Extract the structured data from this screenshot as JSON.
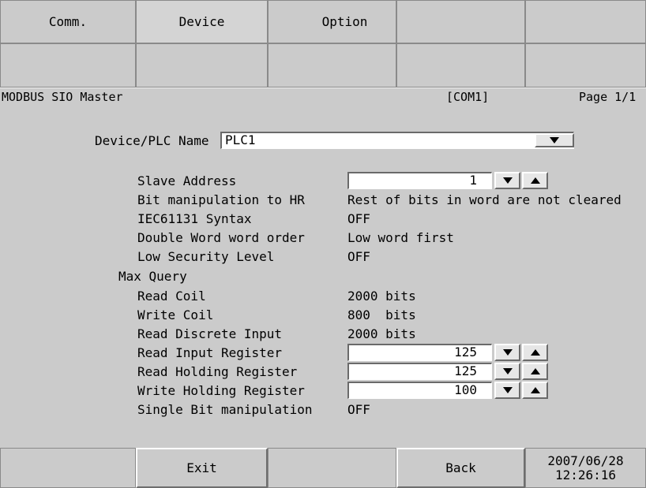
{
  "tabs": [
    {
      "label": "Comm."
    },
    {
      "label": "Device"
    },
    {
      "label": "Option"
    }
  ],
  "header": {
    "driver": "MODBUS SIO Master",
    "port": "[COM1]",
    "page": "Page 1/1"
  },
  "device": {
    "label": "Device/PLC Name",
    "value": "PLC1"
  },
  "settings": {
    "slave_address": {
      "label": "Slave Address",
      "value": "1"
    },
    "bit_manipulation": {
      "label": "Bit manipulation to HR",
      "value": "Rest of bits in word are not cleared"
    },
    "iec_syntax": {
      "label": "IEC61131 Syntax",
      "value": "OFF"
    },
    "dword_order": {
      "label": "Double Word word order",
      "value": "Low word first"
    },
    "low_security": {
      "label": "Low Security Level",
      "value": "OFF"
    },
    "max_query_label": "Max Query",
    "read_coil": {
      "label": "Read Coil",
      "value": "2000 bits"
    },
    "write_coil": {
      "label": "Write Coil",
      "value": "800  bits"
    },
    "read_discrete": {
      "label": "Read Discrete Input",
      "value": "2000 bits"
    },
    "read_input_reg": {
      "label": "Read Input Register",
      "value": "125"
    },
    "read_holding_reg": {
      "label": "Read Holding Register",
      "value": "125"
    },
    "write_holding_reg": {
      "label": "Write Holding Register",
      "value": "100"
    },
    "single_bit": {
      "label": "Single Bit manipulation",
      "value": "OFF"
    }
  },
  "footer": {
    "exit": "Exit",
    "back": "Back",
    "date": "2007/06/28",
    "time": "12:26:16"
  },
  "icons": {
    "spin_down": "triangle-down-icon",
    "spin_up": "triangle-up-icon",
    "dropdown": "triangle-down-icon"
  }
}
